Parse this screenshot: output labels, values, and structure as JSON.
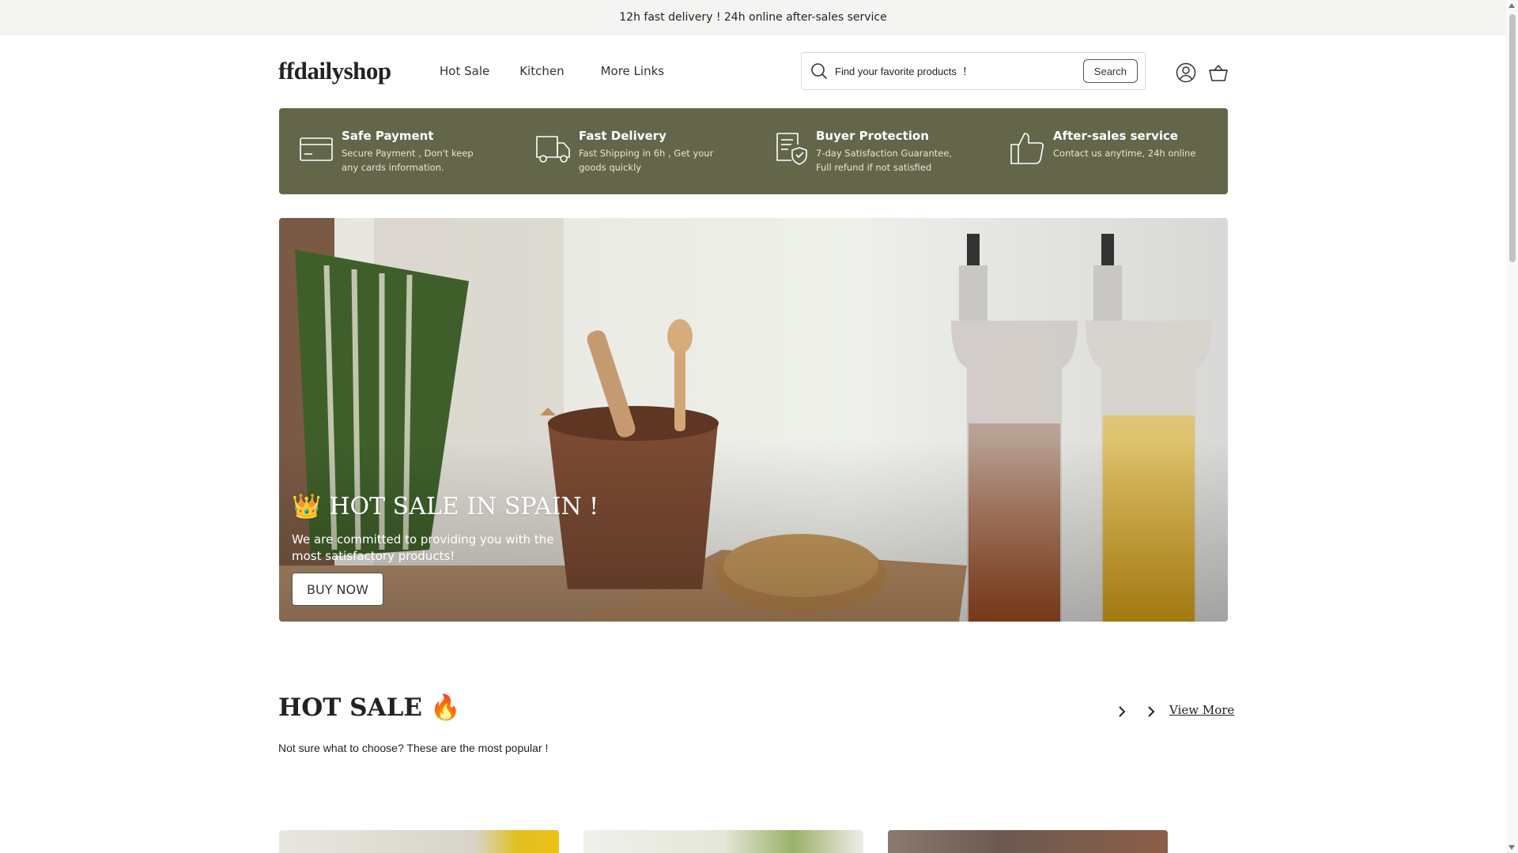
{
  "announcement": "12h fast delivery ! 24h online after-sales service",
  "header": {
    "logo": "ffdailyshop",
    "nav": [
      "Hot Sale",
      "Kitchen",
      "More Links"
    ],
    "search_placeholder": "Find your favorite products  ！",
    "search_button": "Search",
    "icons": [
      "account-icon",
      "cart-icon"
    ]
  },
  "features": [
    {
      "title": "Safe Payment",
      "desc": "Secure Payment , Don't keep any cards information.",
      "icon": "credit-card-icon"
    },
    {
      "title": "Fast Delivery",
      "desc": "Fast Shipping in 6h , Get your goods quickly",
      "icon": "truck-icon"
    },
    {
      "title": "Buyer Protection",
      "desc": "7-day Satisfaction Guarantee, Full refund if not satisfied",
      "icon": "shield-check-icon"
    },
    {
      "title": "After-sales service",
      "desc": "Contact us anytime, 24h online",
      "icon": "thumbs-up-icon"
    }
  ],
  "hero": {
    "emoji": "👑",
    "title": "HOT SALE IN SPAIN !",
    "desc": "We are committed to providing you with the most satisfactory products!",
    "button": "BUY NOW"
  },
  "section": {
    "title": "HOT SALE",
    "emoji": "🔥",
    "subtitle": "Not sure what to choose? These are the most popular !",
    "view_more": "View More"
  },
  "colors": {
    "feature_bar": "#646649",
    "announcement_bg": "#f4f4f2"
  }
}
